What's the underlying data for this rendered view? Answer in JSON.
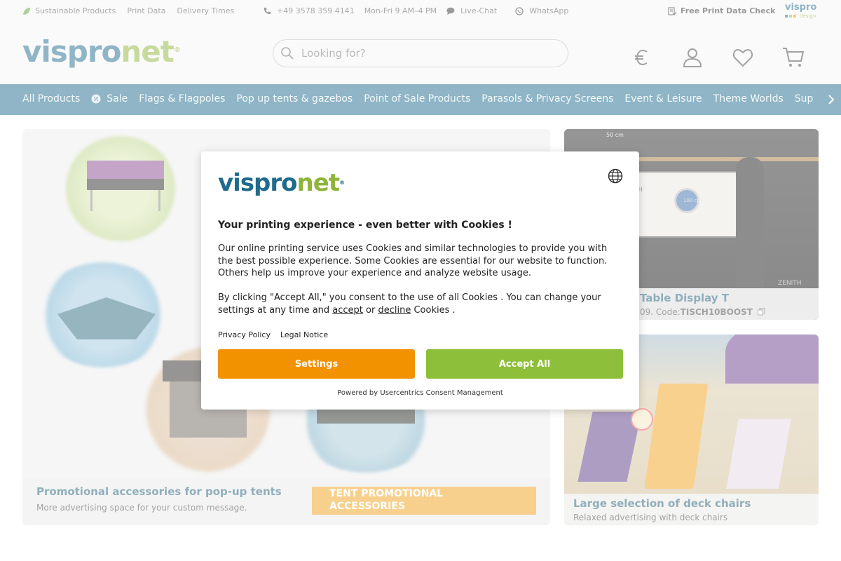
{
  "topbar": {
    "sustainable": "Sustainable Products",
    "print_data": "Print Data",
    "delivery": "Delivery Times",
    "phone": "+49 3578 359 4141",
    "hours": "Mon-Fri 9 AM–4 PM",
    "livechat": "Live-Chat",
    "whatsapp": "WhatsApp",
    "print_check": "Free Print Data Check",
    "design_logo_top": "vispro",
    "design_logo_bottom": "design"
  },
  "header": {
    "logo_part1": "vispro",
    "logo_part2": "net",
    "search_placeholder": "Looking for?"
  },
  "catnav": {
    "items": [
      "All Products",
      "Sale",
      "Flags & Flagpoles",
      "Pop up tents & gazebos",
      "Point of Sale Products",
      "Parasols & Privacy Screens",
      "Event & Leisure",
      "Theme Worlds",
      "Sup"
    ]
  },
  "hero": {
    "title": "Promotional accessories for pop-up tents",
    "subtitle": "More advertising space for your custom message.",
    "cta": "TENT PROMOTIONAL ACCESSORIES"
  },
  "card1": {
    "title": "Table Display T",
    "sub_prefix": "09. Code:",
    "code": "TISCH10BOOST",
    "dim_50": "50 cm",
    "dim_100": "100 cm",
    "brand": "ZENITH"
  },
  "card2": {
    "title": "Large selection of deck chairs",
    "subtitle": "Relaxed advertising with deck chairs"
  },
  "modal": {
    "logo_part1": "vispro",
    "logo_part2": "net",
    "title": "Your printing experience - even better with Cookies !",
    "para1": "Our online printing service uses Cookies and similar technologies to provide you with the best possible experience. Some Cookies are essential for our website to function. Others help us improve your experience and analyze website usage.",
    "para2_a": "By clicking \"Accept All,\" you consent to the use of all Cookies . You can change your settings at any time and ",
    "accept_link": "accept",
    "para2_or": " or ",
    "decline_link": "decline",
    "para2_b": " Cookies .",
    "privacy": "Privacy Policy",
    "legal": "Legal Notice",
    "settings_btn": "Settings",
    "accept_btn": "Accept All",
    "powered": "Powered by Usercentrics Consent Management"
  },
  "colors": {
    "brand_blue": "#1f6b8c",
    "brand_green": "#8fb43a",
    "orange": "#f39200",
    "accept_green": "#8dbf3a"
  }
}
